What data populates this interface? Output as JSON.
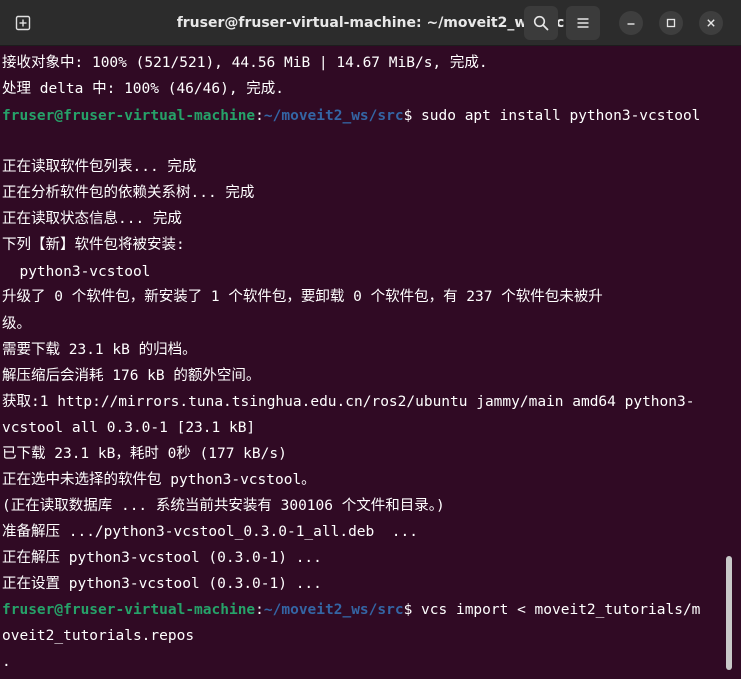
{
  "window": {
    "title": "fruser@fruser-virtual-machine: ~/moveit2_ws/src"
  },
  "header": {
    "new_tab_icon": "new-tab-icon",
    "search_icon": "search-icon",
    "menu_icon": "hamburger-menu-icon",
    "minimize_icon": "minimize-icon",
    "maximize_icon": "maximize-icon",
    "close_icon": "close-icon"
  },
  "prompt": {
    "user_host": "fruser@fruser-virtual-machine",
    "colon": ":",
    "path": "~/moveit2_ws/src",
    "dollar": "$"
  },
  "terminal": {
    "line1": "接收对象中: 100% (521/521), 44.56 MiB | 14.67 MiB/s, 完成.",
    "line2": "处理 delta 中: 100% (46/46), 完成.",
    "cmd1": " sudo apt install python3-vcstool",
    "line4": "",
    "line5": "正在读取软件包列表... 完成",
    "line6": "正在分析软件包的依赖关系树... 完成",
    "line7": "正在读取状态信息... 完成",
    "line8": "下列【新】软件包将被安装:",
    "line9": "  python3-vcstool",
    "line10": "升级了 0 个软件包，新安装了 1 个软件包，要卸载 0 个软件包，有 237 个软件包未被升",
    "line11": "级。",
    "line12": "需要下载 23.1 kB 的归档。",
    "line13": "解压缩后会消耗 176 kB 的额外空间。",
    "line14": "获取:1 http://mirrors.tuna.tsinghua.edu.cn/ros2/ubuntu jammy/main amd64 python3-",
    "line15": "vcstool all 0.3.0-1 [23.1 kB]",
    "line16": "已下载 23.1 kB，耗时 0秒 (177 kB/s)",
    "line17": "正在选中未选择的软件包 python3-vcstool。",
    "line18": "(正在读取数据库 ... 系统当前共安装有 300106 个文件和目录。)",
    "line19": "准备解压 .../python3-vcstool_0.3.0-1_all.deb  ...",
    "line20": "正在解压 python3-vcstool (0.3.0-1) ...",
    "line21": "正在设置 python3-vcstool (0.3.0-1) ...",
    "cmd2": " vcs import < moveit2_tutorials/m",
    "line23": "oveit2_tutorials.repos",
    "line24": "."
  }
}
